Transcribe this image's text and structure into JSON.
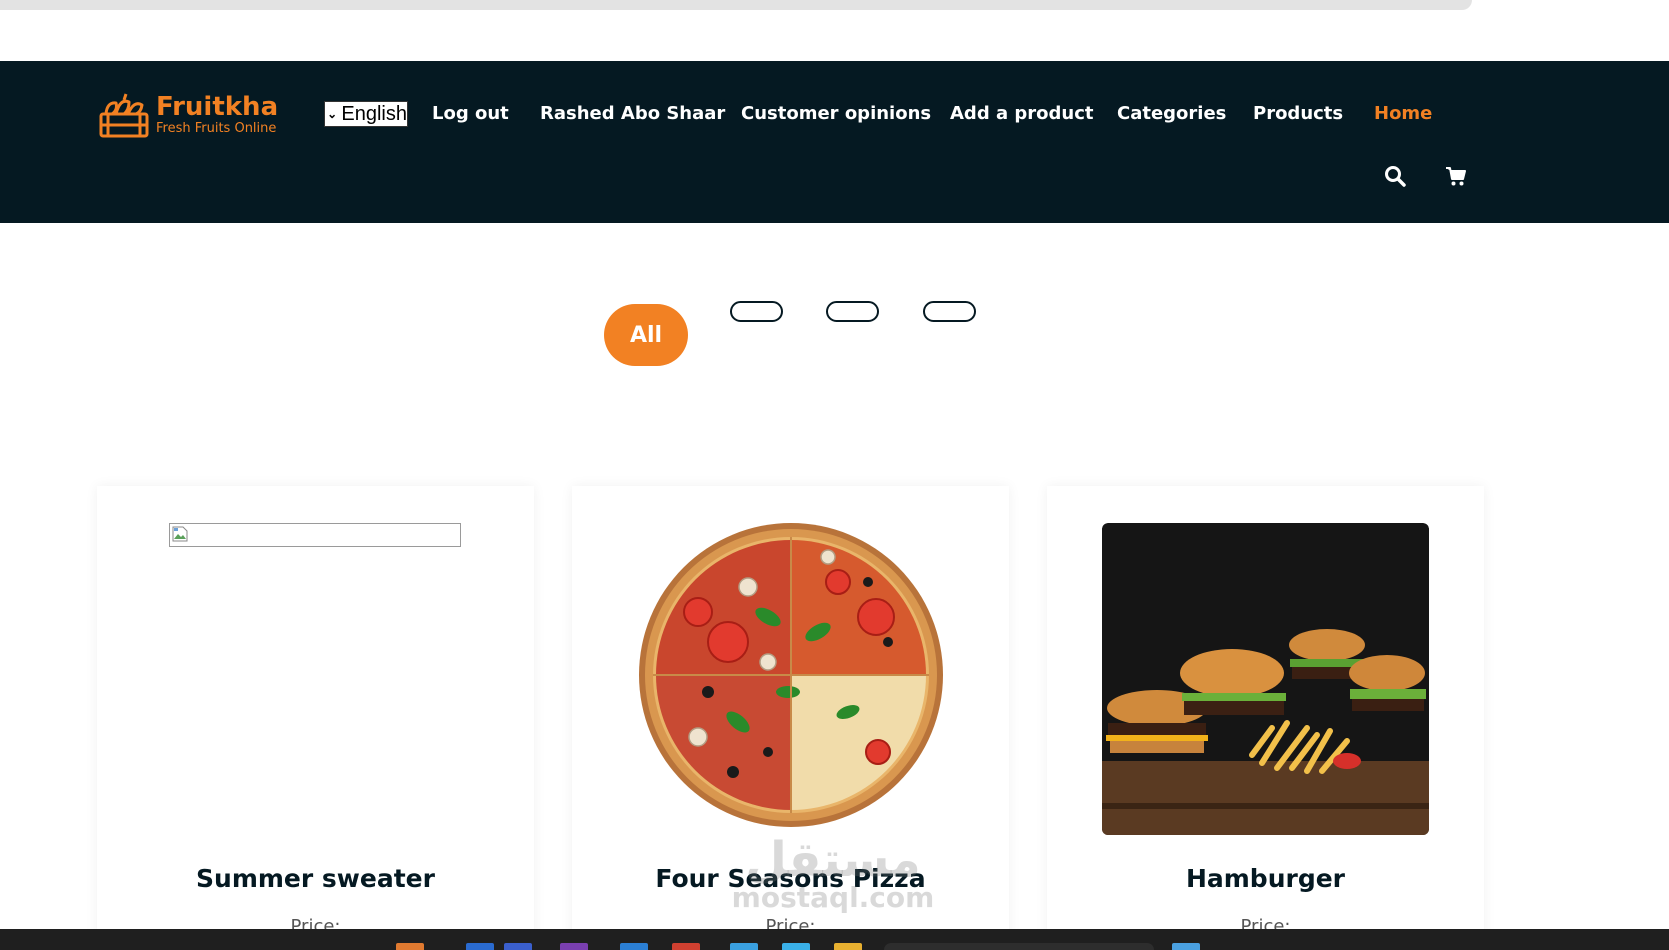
{
  "logo": {
    "name": "Fruitkha",
    "tagline": "Fresh Fruits Online",
    "icon": "fruit-basket-icon"
  },
  "language_select": {
    "value": "English"
  },
  "nav": {
    "items": [
      {
        "label": "Log out"
      },
      {
        "label": "Rashed Abo Shaar"
      },
      {
        "label": "Customer opinions"
      },
      {
        "label": "Add a product"
      },
      {
        "label": "Categories"
      },
      {
        "label": "Products"
      },
      {
        "label": "Home",
        "active": true
      }
    ],
    "icons": [
      "search-icon",
      "cart-icon"
    ]
  },
  "filters": {
    "all_label": "All",
    "empty_count": 3
  },
  "products": [
    {
      "title": "Summer sweater",
      "price_label": "Price:",
      "image": "broken-image"
    },
    {
      "title": "Four Seasons Pizza",
      "price_label": "Price:",
      "image": "pizza"
    },
    {
      "title": "Hamburger",
      "price_label": "Price:",
      "image": "hamburgers-and-fries"
    }
  ],
  "watermark": {
    "line1": "مستقل",
    "line2": "mostaql.com"
  },
  "colors": {
    "nav_bg": "#051922",
    "accent": "#f28123",
    "text_dark": "#051922"
  }
}
